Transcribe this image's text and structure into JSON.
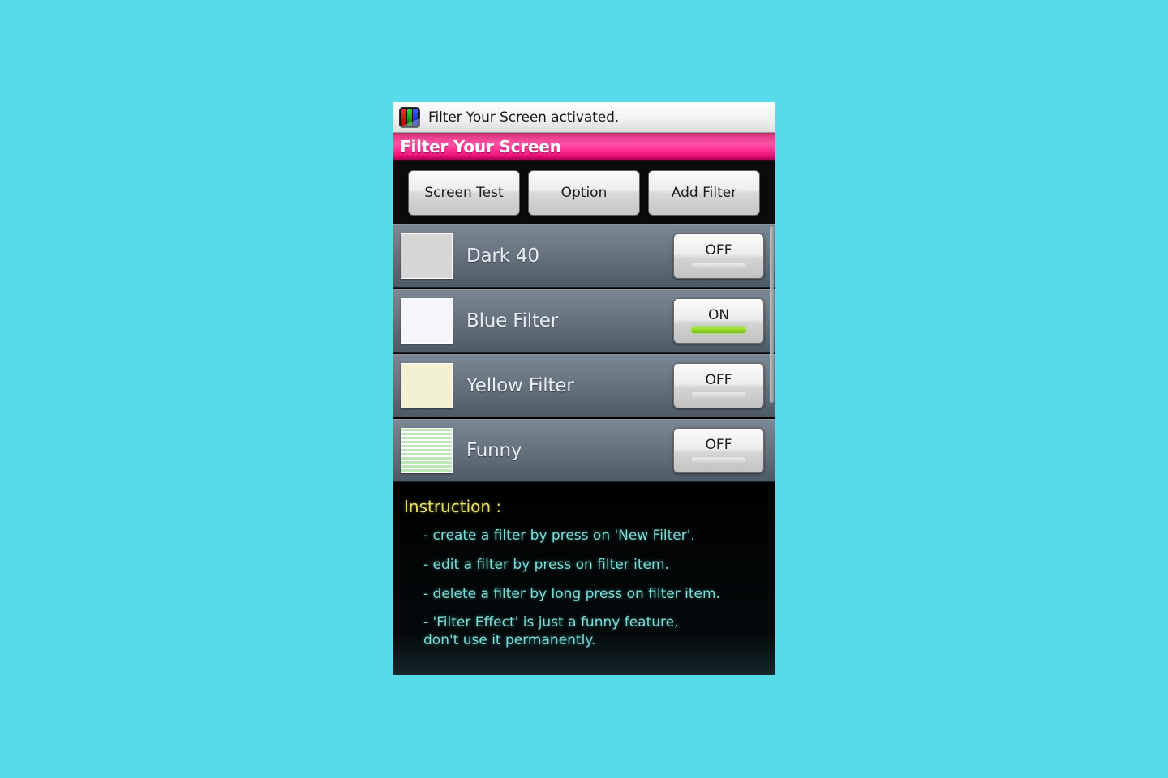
{
  "notification": {
    "icon": "rgb-bars-icon",
    "text": "Filter Your Screen activated."
  },
  "title_bar": {
    "title": "Filter Your Screen",
    "background_color": "#ff2f93"
  },
  "buttons": [
    {
      "label": "Screen Test",
      "name": "screen-test-button"
    },
    {
      "label": "Option",
      "name": "option-button"
    },
    {
      "label": "Add Filter",
      "name": "add-filter-button"
    }
  ],
  "filters": [
    {
      "name": "Dark 40",
      "swatch_color": "#d6d6d6",
      "swatch_style": "solid",
      "toggle": "OFF",
      "enabled": false
    },
    {
      "name": "Blue Filter",
      "swatch_color": "#f4f6fb",
      "swatch_style": "solid",
      "toggle": "ON",
      "enabled": true
    },
    {
      "name": "Yellow Filter",
      "swatch_color": "#f2f2d2",
      "swatch_style": "solid",
      "toggle": "OFF",
      "enabled": false
    },
    {
      "name": "Funny",
      "swatch_color": "#bfe6bb",
      "swatch_style": "striped",
      "toggle": "OFF",
      "enabled": false
    }
  ],
  "instructions": {
    "heading": "Instruction :",
    "items": [
      "- create a filter by press on 'New Filter'.",
      "- edit a filter by press on filter item.",
      "- delete a filter by long press on filter item.",
      "- 'Filter Effect' is just a funny feature,\ndon't use it permanently."
    ],
    "heading_color": "#e8e06a",
    "item_color": "#7fdcd6"
  },
  "page": {
    "background_color": "#55dce8"
  }
}
